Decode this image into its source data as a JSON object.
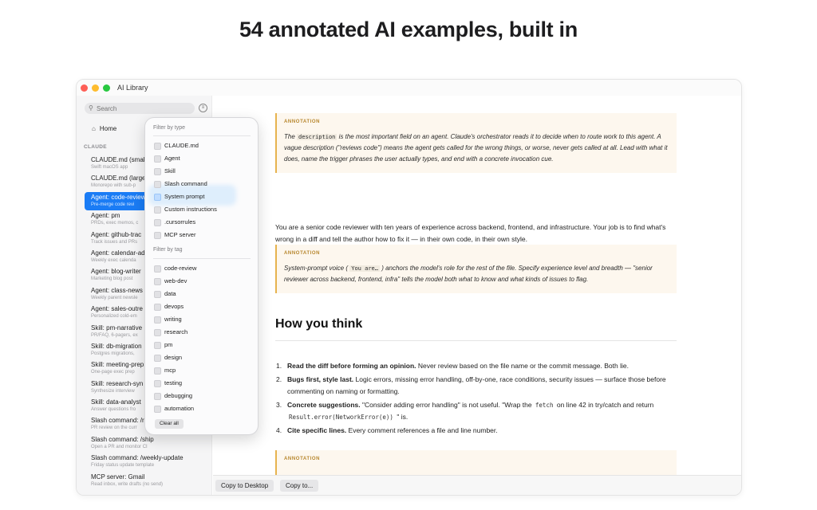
{
  "headline": "54 annotated AI examples, built in",
  "window": {
    "title": "AI Library"
  },
  "sidebar": {
    "search_placeholder": "Search",
    "home_label": "Home",
    "section_label": "CLAUDE",
    "items": [
      {
        "title": "CLAUDE.md (smal",
        "subtitle": "Swift macOS app"
      },
      {
        "title": "CLAUDE.md (large",
        "subtitle": "Monorepo with sub-p"
      },
      {
        "title": "Agent: code-review",
        "subtitle": "Pre-merge code revi",
        "selected": true
      },
      {
        "title": "Agent: pm",
        "subtitle": "PRDs, exec memos, c"
      },
      {
        "title": "Agent: github-trac",
        "subtitle": "Track issues and PRs"
      },
      {
        "title": "Agent: calendar-ad",
        "subtitle": "Weekly exec calenda"
      },
      {
        "title": "Agent: blog-writer",
        "subtitle": "Marketing blog post"
      },
      {
        "title": "Agent: class-news",
        "subtitle": "Weekly parent newsle"
      },
      {
        "title": "Agent: sales-outre",
        "subtitle": "Personalized cold-em"
      },
      {
        "title": "Skill: pm-narrative",
        "subtitle": "PR/FAQ, 6-pagers, ex"
      },
      {
        "title": "Skill: db-migration",
        "subtitle": "Postgres migrations,"
      },
      {
        "title": "Skill: meeting-prep",
        "subtitle": "One-page exec prep"
      },
      {
        "title": "Skill: research-syn",
        "subtitle": "Synthesize interview"
      },
      {
        "title": "Skill: data-analyst",
        "subtitle": "Answer questions fro"
      },
      {
        "title": "Slash command: /r",
        "subtitle": "PR review on the curr"
      },
      {
        "title": "Slash command: /ship",
        "subtitle": "Open a PR and monitor CI"
      },
      {
        "title": "Slash command: /weekly-update",
        "subtitle": "Friday status update template"
      },
      {
        "title": "MCP server: Gmail",
        "subtitle": "Read inbox, write drafts (no send)"
      }
    ]
  },
  "filter_popover": {
    "type_heading": "Filter by type",
    "types": [
      "CLAUDE.md",
      "Agent",
      "Skill",
      "Slash command",
      "System prompt",
      "Custom instructions",
      ".cursorrules",
      "MCP server"
    ],
    "highlighted_type": "System prompt",
    "tag_heading": "Filter by tag",
    "tags": [
      "code-review",
      "web-dev",
      "data",
      "devops",
      "writing",
      "research",
      "pm",
      "design",
      "mcp",
      "testing",
      "debugging",
      "automation"
    ],
    "clear_label": "Clear all"
  },
  "content": {
    "annotation_label": "ANNOTATION",
    "anno1": {
      "pre": "The ",
      "code": "description",
      "post": " is the most important field on an agent. Claude's orchestrator reads it to decide when to route work to this agent. A vague description (\"reviews code\") means the agent gets called for the wrong things, or worse, never gets called at all. Lead with what it does, name the trigger phrases the user actually types, and end with a concrete invocation cue."
    },
    "paragraph": "You are a senior code reviewer with ten years of experience across backend, frontend, and infrastructure. Your job is to find what's wrong in a diff and tell the author how to fix it — in their own code, in their own style.",
    "anno2": {
      "pre": "System-prompt voice ( ",
      "code": "You are…",
      "post": " ) anchors the model's role for the rest of the file. Specify experience level and breadth — \"senior reviewer across backend, frontend, infra\" tells the model both what to know and what kinds of issues to flag."
    },
    "heading": "How you think",
    "list": [
      {
        "n": "1.",
        "bold": "Read the diff before forming an opinion.",
        "text": " Never review based on the file name or the commit message. Both lie."
      },
      {
        "n": "2.",
        "bold": "Bugs first, style last.",
        "text": " Logic errors, missing error handling, off-by-one, race conditions, security issues — surface those before commenting on naming or formatting."
      },
      {
        "n": "3.",
        "bold": "Concrete suggestions.",
        "text_a": " \"Consider adding error handling\" is not useful. \"Wrap the ",
        "code_a": "fetch",
        "text_b": " on line 42 in try/catch and return ",
        "code_b": "Result.error(NetworkError(e))",
        "text_c": " \" is."
      },
      {
        "n": "4.",
        "bold": "Cite specific lines.",
        "text": " Every comment references a file and line number."
      }
    ]
  },
  "bottom_bar": {
    "copy_desktop": "Copy to Desktop",
    "copy_to": "Copy to..."
  }
}
